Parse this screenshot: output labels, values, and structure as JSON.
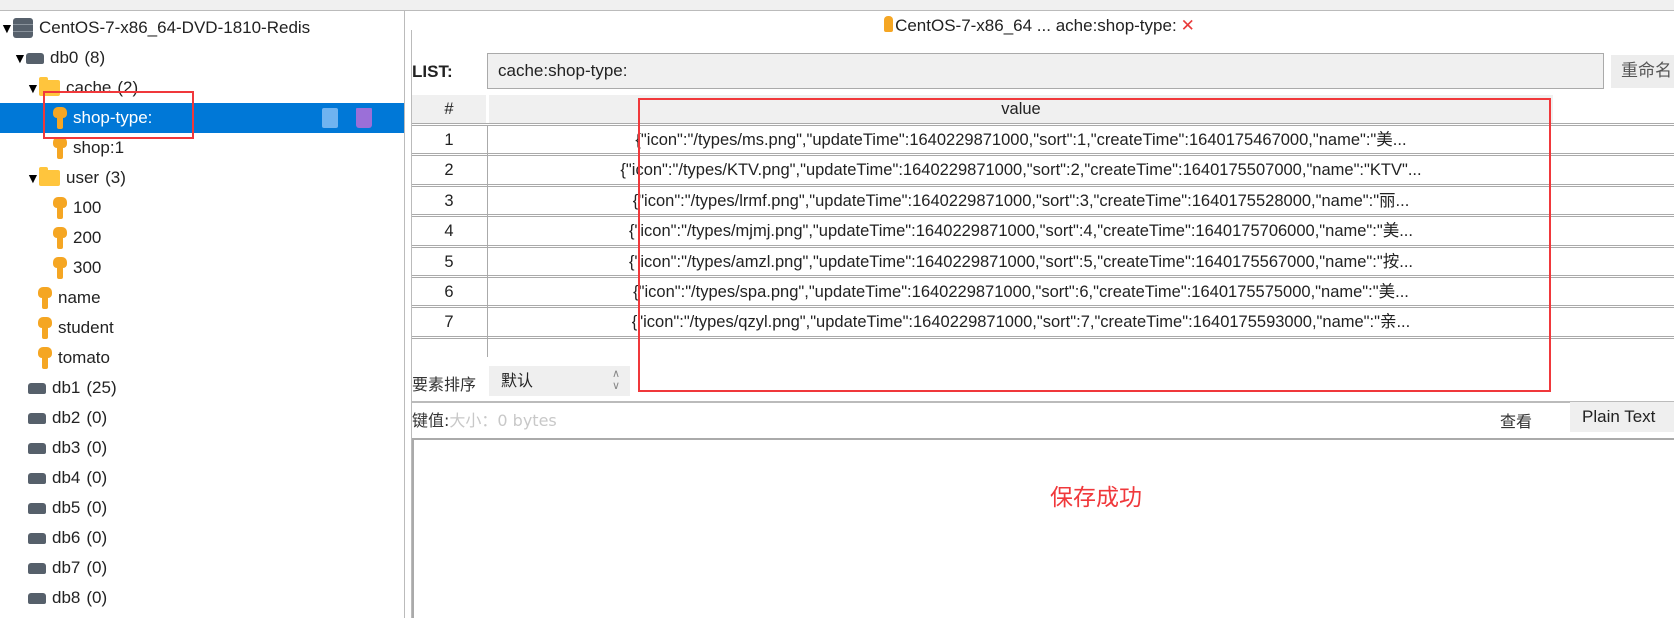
{
  "tree": {
    "items": [
      {
        "type": "server",
        "label": "CentOS-7-x86_64-DVD-1810-Redis",
        "count": "",
        "expanded": true,
        "level": 0
      },
      {
        "type": "db",
        "label": "db0",
        "count": "(8)",
        "expanded": true,
        "level": 1
      },
      {
        "type": "folder",
        "label": "cache",
        "count": "(2)",
        "expanded": true,
        "level": 2
      },
      {
        "type": "key",
        "label": "shop-type:",
        "count": "",
        "selected": true,
        "level": 3
      },
      {
        "type": "key",
        "label": "shop:1",
        "count": "",
        "level": 3
      },
      {
        "type": "folder",
        "label": "user",
        "count": "(3)",
        "expanded": true,
        "level": 2
      },
      {
        "type": "key",
        "label": "100",
        "count": "",
        "level": 3
      },
      {
        "type": "key",
        "label": "200",
        "count": "",
        "level": 3
      },
      {
        "type": "key",
        "label": "300",
        "count": "",
        "level": 3
      },
      {
        "type": "key",
        "label": "name",
        "count": "",
        "level": 2
      },
      {
        "type": "key",
        "label": "student",
        "count": "",
        "level": 2
      },
      {
        "type": "key",
        "label": "tomato",
        "count": "",
        "level": 2
      },
      {
        "type": "db",
        "label": "db1",
        "count": "(25)",
        "level": 1
      },
      {
        "type": "db",
        "label": "db2",
        "count": "(0)",
        "level": 1
      },
      {
        "type": "db",
        "label": "db3",
        "count": "(0)",
        "level": 1
      },
      {
        "type": "db",
        "label": "db4",
        "count": "(0)",
        "level": 1
      },
      {
        "type": "db",
        "label": "db5",
        "count": "(0)",
        "level": 1
      },
      {
        "type": "db",
        "label": "db6",
        "count": "(0)",
        "level": 1
      },
      {
        "type": "db",
        "label": "db7",
        "count": "(0)",
        "level": 1
      },
      {
        "type": "db",
        "label": "db8",
        "count": "(0)",
        "level": 1
      }
    ]
  },
  "tab": {
    "title": "CentOS-7-x86_64 ... ache:shop-type:",
    "close": "✕"
  },
  "key": {
    "type_label": "LIST:",
    "name": "cache:shop-type:",
    "rename_label": "重命名"
  },
  "table": {
    "headers": [
      "#",
      "value"
    ],
    "rows": [
      {
        "num": "1",
        "value": "{\"icon\":\"/types/ms.png\",\"updateTime\":1640229871000,\"sort\":1,\"createTime\":1640175467000,\"name\":\"美..."
      },
      {
        "num": "2",
        "value": "{\"icon\":\"/types/KTV.png\",\"updateTime\":1640229871000,\"sort\":2,\"createTime\":1640175507000,\"name\":\"KTV\"..."
      },
      {
        "num": "3",
        "value": "{\"icon\":\"/types/lrmf.png\",\"updateTime\":1640229871000,\"sort\":3,\"createTime\":1640175528000,\"name\":\"丽..."
      },
      {
        "num": "4",
        "value": "{\"icon\":\"/types/mjmj.png\",\"updateTime\":1640229871000,\"sort\":4,\"createTime\":1640175706000,\"name\":\"美..."
      },
      {
        "num": "5",
        "value": "{\"icon\":\"/types/amzl.png\",\"updateTime\":1640229871000,\"sort\":5,\"createTime\":1640175567000,\"name\":\"按..."
      },
      {
        "num": "6",
        "value": "{\"icon\":\"/types/spa.png\",\"updateTime\":1640229871000,\"sort\":6,\"createTime\":1640175575000,\"name\":\"美..."
      },
      {
        "num": "7",
        "value": "{\"icon\":\"/types/qzyl.png\",\"updateTime\":1640229871000,\"sort\":7,\"createTime\":1640175593000,\"name\":\"亲..."
      }
    ]
  },
  "sort": {
    "label": "要素排序",
    "value": "默认"
  },
  "value_panel": {
    "label": "键值:",
    "size": "大小：0 bytes",
    "view_label": "查看",
    "view_mode": "Plain Text"
  },
  "toast": "保存成功",
  "colors": {
    "selection": "#0078d7",
    "highlight_box": "#f0383b",
    "toast": "#f0383b",
    "key_icon": "#f5a623",
    "folder_icon": "#ffc53d"
  }
}
